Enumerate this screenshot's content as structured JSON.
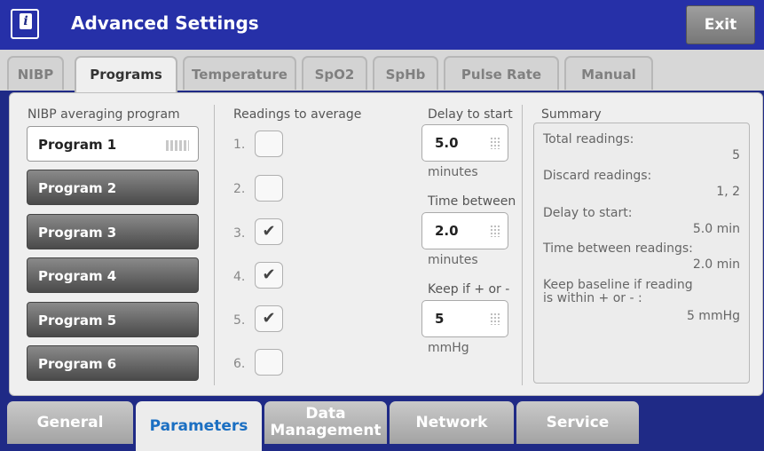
{
  "header": {
    "title": "Advanced Settings",
    "exit_label": "Exit",
    "logo_glyph": "i"
  },
  "tabs": [
    "NIBP",
    "Programs",
    "Temperature",
    "SpO2",
    "SpHb",
    "Pulse Rate",
    "Manual"
  ],
  "active_tab": "Programs",
  "programs": {
    "label": "NIBP averaging program",
    "items": [
      "Program 1",
      "Program 2",
      "Program 3",
      "Program 4",
      "Program 5",
      "Program 6"
    ],
    "selected": "Program 1"
  },
  "readings": {
    "label": "Readings to average",
    "rows": [
      {
        "number": "1.",
        "checked": false
      },
      {
        "number": "2.",
        "checked": false
      },
      {
        "number": "3.",
        "checked": true
      },
      {
        "number": "4.",
        "checked": true
      },
      {
        "number": "5.",
        "checked": true
      },
      {
        "number": "6.",
        "checked": false
      }
    ],
    "check_glyph": "✔"
  },
  "fields": {
    "delay_label": "Delay to start",
    "delay_value": "5.0",
    "delay_unit": "minutes",
    "between_label": "Time between",
    "between_value": "2.0",
    "between_unit": "minutes",
    "keep_label": "Keep if + or -",
    "keep_value": "5",
    "keep_unit": "mmHg"
  },
  "summary": {
    "label": "Summary",
    "total_label": "Total readings:",
    "total_value": "5",
    "discard_label": "Discard readings:",
    "discard_value": "1, 2",
    "delay_label": "Delay to start:",
    "delay_value": "5.0 min",
    "between_label": "Time between readings:",
    "between_value": "2.0 min",
    "keep_label_1": "Keep baseline if reading",
    "keep_label_2": "is within + or - :",
    "keep_value": "5 mmHg"
  },
  "bottom_tabs": [
    "General",
    "Parameters",
    "Data Management",
    "Network",
    "Service"
  ],
  "bottom_active": "Parameters",
  "colors": {
    "header_bg": "#2630a8",
    "bottom_bg": "#1f2a86",
    "active_bottom_text": "#1b6fc2"
  }
}
